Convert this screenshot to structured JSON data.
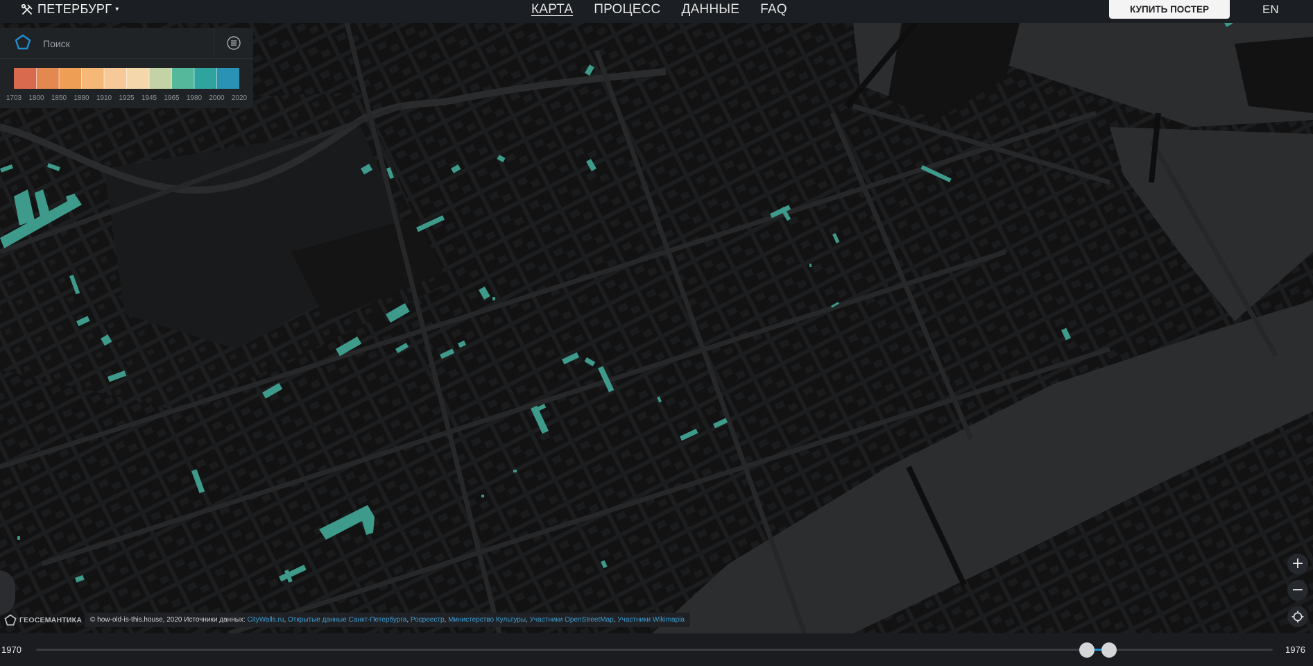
{
  "header": {
    "city": "ПЕТЕРБУРГ",
    "city_caret": "▾",
    "nav": [
      {
        "label": "КАРТА",
        "active": true
      },
      {
        "label": "ПРОЦЕСС",
        "active": false
      },
      {
        "label": "ДАННЫЕ",
        "active": false
      },
      {
        "label": "FAQ",
        "active": false
      }
    ],
    "buy_label": "КУПИТЬ ПОСТЕР",
    "lang_label": "EN"
  },
  "search": {
    "placeholder": "Поиск",
    "logo_icon": "geosemantica-logo-icon",
    "layers_icon": "list-icon"
  },
  "legend": {
    "years": [
      "1703",
      "1800",
      "1850",
      "1880",
      "1910",
      "1925",
      "1945",
      "1965",
      "1980",
      "2000",
      "2020"
    ],
    "colors": [
      "#d96a4d",
      "#e3884f",
      "#ee9f55",
      "#f5b877",
      "#f8c998",
      "#f5d7ac",
      "#c3d3a5",
      "#55b89a",
      "#2fa39d",
      "#2a92b5"
    ]
  },
  "map": {
    "water_color": "#2c2d2f",
    "building_color": "#0f0f10",
    "road_color": "#222325",
    "highlight_color": "#3e9a8a"
  },
  "attribution": {
    "logo_text": "ГЕОСЕМАНТИКА",
    "copyright": "© how-old-is-this.house, 2020 Источники данных: ",
    "sources": [
      "CityWalls.ru",
      "Открытые данные Санкт-Петербурга",
      "Росреестр",
      "Министерство Культуры",
      "Участники OpenStreetMap",
      "Участники Wikimapia"
    ],
    "separator": ", "
  },
  "controls": {
    "zoom_in_label": "+",
    "zoom_out_label": "−",
    "locate_icon": "crosshair-icon"
  },
  "timeline": {
    "start_label": "1970",
    "end_label": "1976",
    "min_year": 1703,
    "max_year": 2020,
    "range_start_fraction": 0.8495,
    "range_end_fraction": 0.8675
  }
}
